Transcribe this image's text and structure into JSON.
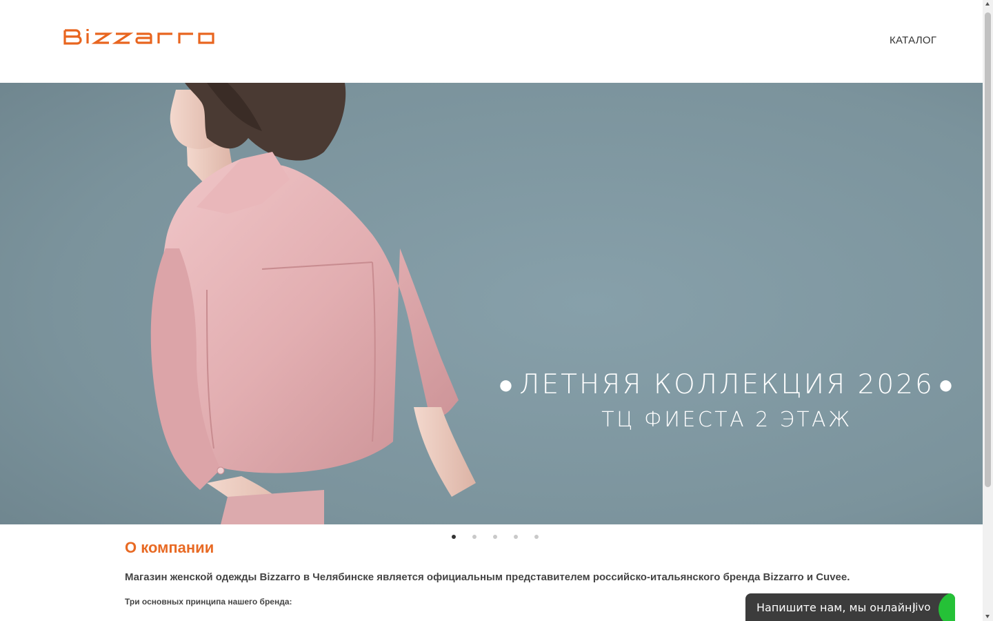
{
  "header": {
    "logo_text": "BIZZARRO",
    "nav": {
      "catalog_label": "КАТАЛОГ"
    }
  },
  "hero": {
    "title": "ЛЕТНЯЯ КОЛЛЕКЦИЯ 2026",
    "title_bullet": "●",
    "subtitle": "ТЦ ФИЕСТА 2 ЭТАЖ",
    "slide_count": 5,
    "active_slide": 1
  },
  "about": {
    "title": "О компании",
    "text": "Магазин женской одежды Bizzarro в Челябинске является официальным представителем российско-итальянского бренда Bizzarro и Cuvee.",
    "principles_heading": "Три основных принципа нашего бренда:"
  },
  "chat_widget": {
    "text": "Напишите нам, мы онлайн!",
    "brand": "jivo"
  },
  "colors": {
    "accent": "#e86a24",
    "hero_bg": "#7e939c",
    "chat_bg": "#3c3c3c",
    "chat_green": "#25c137"
  }
}
